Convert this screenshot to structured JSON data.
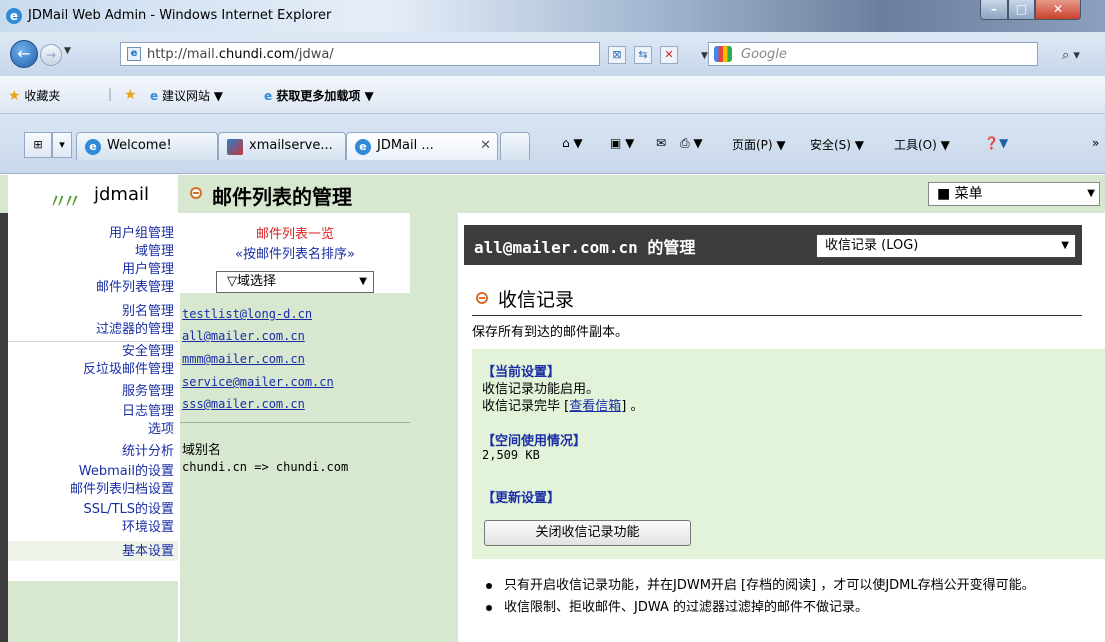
{
  "window": {
    "title": "JDMail Web Admin - Windows Internet Explorer",
    "minimize": "–",
    "maximize": "□",
    "close": "✕"
  },
  "address_bar": {
    "url_prefix": "http://mail.",
    "url_domain": "chundi.com",
    "url_suffix": "/jdwa/",
    "search_placeholder": "Google"
  },
  "favorites_bar": {
    "favorites": "收藏夹",
    "suggested_sites": "建议网站 ▼",
    "get_addons": "获取更多加载项 ▼"
  },
  "tabs": [
    {
      "label": "Welcome!"
    },
    {
      "label": "xmailserve..."
    },
    {
      "label": "JDMail ..."
    }
  ],
  "commands": {
    "page": "页面(P) ▼",
    "safety": "安全(S) ▼",
    "tools": "工具(O) ▼"
  },
  "header": {
    "logo": "jdmail",
    "title": "邮件列表的管理",
    "menu_select": "■ 菜单"
  },
  "left_nav": [
    "用户组管理",
    "域管理",
    "用户管理",
    "邮件列表管理",
    "别名管理",
    "过滤器的管理",
    "安全管理",
    "反垃圾邮件管理",
    "服务管理",
    "日志管理",
    "选项",
    "统计分析",
    "Webmail的设置",
    "邮件列表归档设置",
    "SSL/TLS的设置",
    "环境设置",
    "基本设置"
  ],
  "mid": {
    "title": "邮件列表一览",
    "sort_link": "«按邮件列表名排序»",
    "domain_select": "▽域选择",
    "lists": [
      "testlist@long-d.cn",
      "all@mailer.com.cn",
      "mmm@mailer.com.cn",
      "service@mailer.com.cn",
      "sss@mailer.com.cn"
    ],
    "alias_heading": "域别名",
    "alias_value": "chundi.cn => chundi.com"
  },
  "main": {
    "mgmt_title": "all@mailer.com.cn 的管理",
    "log_select": "收信记录 (LOG)",
    "section_title": "收信记录",
    "section_desc": "保存所有到达的邮件副本。",
    "current_settings_h": "【当前设置】",
    "current_line1": "收信记录功能启用。",
    "current_line2_pre": "收信记录完毕 [",
    "current_line2_link": "查看信箱",
    "current_line2_post": "] 。",
    "space_h": "【空间使用情况】",
    "space_value": "2,509 KB",
    "update_h": "【更新设置】",
    "close_button": "关闭收信记录功能",
    "notes": [
      "只有开启收信记录功能，并在JDWM开启 [存档的阅读] ，才可以使JDML存档公开变得可能。",
      "收信限制、拒收邮件、JDWA 的过滤器过滤掉的邮件不做记录。"
    ]
  }
}
